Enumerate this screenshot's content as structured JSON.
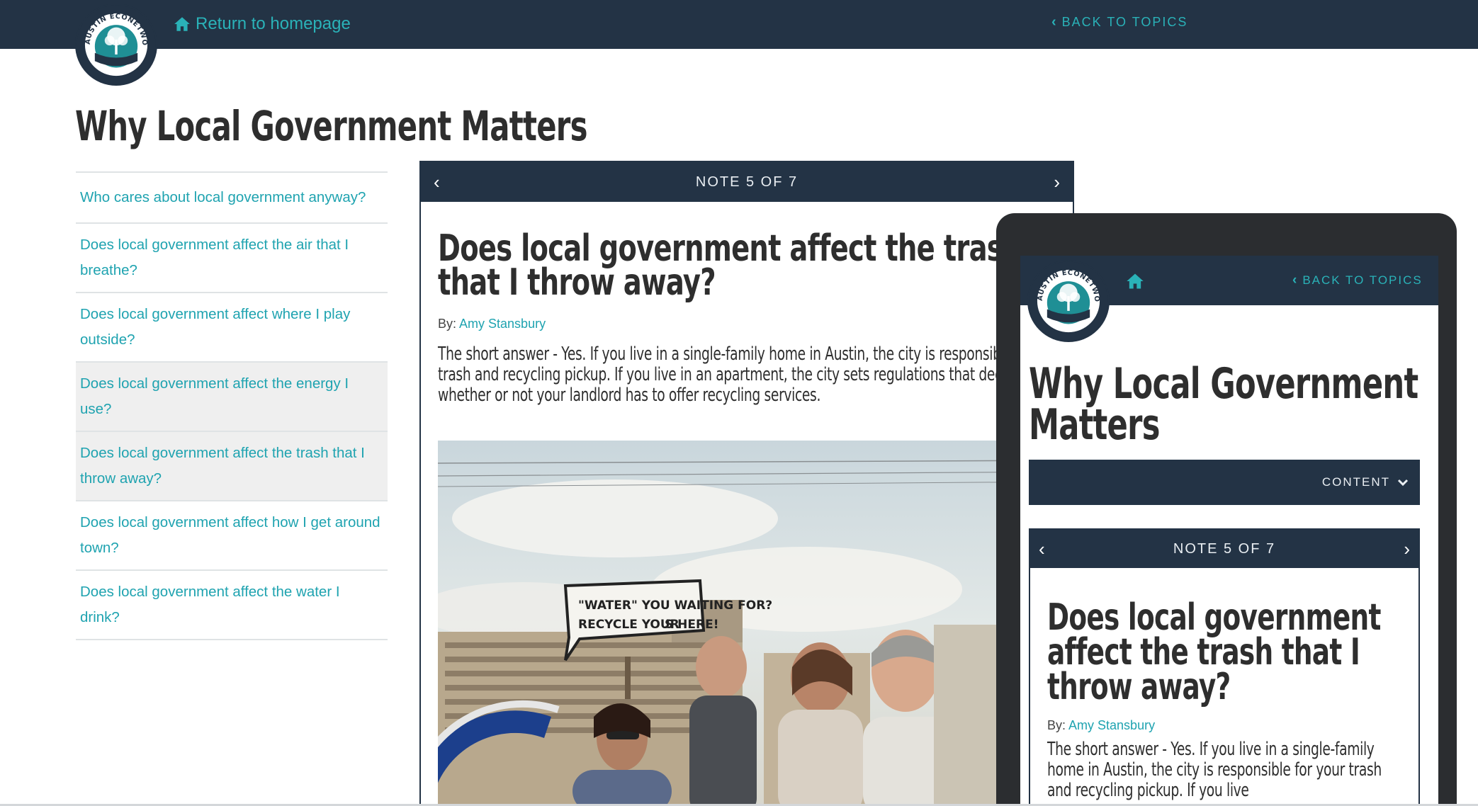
{
  "nav": {
    "home_link": "Return to homepage",
    "back_link": "BACK TO TOPICS"
  },
  "logo": {
    "text": "AUSTIN ECONETWORK"
  },
  "page": {
    "title": "Why Local Government Matters"
  },
  "toc": {
    "items": [
      {
        "label": "Who cares about local government anyway?"
      },
      {
        "label": "Does local government affect the air that I breathe?"
      },
      {
        "label": "Does local government affect where I play outside?"
      },
      {
        "label": "Does local government affect the energy I use?"
      },
      {
        "label": "Does local government affect the trash that I throw away?"
      },
      {
        "label": "Does local government affect how I get around town?"
      },
      {
        "label": "Does local government affect the water I drink?"
      }
    ]
  },
  "note": {
    "counter": "NOTE 5 OF 7",
    "title": "Does local government affect the trash that I throw away?",
    "by_label": "By:",
    "author": "Amy Stansbury",
    "text": "The short answer - Yes. If you live in a single-family home in Austin, the city is responsible for your trash and recycling pickup. If you live in an apartment, the city sets regulations that decide whether or not your landlord has to offer recycling services.",
    "photo_sign_line1": "\"WATER\" YOU WAITING FOR?",
    "photo_sign_line2": "RECYCLE YOUR",
    "photo_sign_line3": "S HERE!"
  },
  "tablet": {
    "back_link": "BACK TO TOPICS",
    "title": "Why Local Government Matters",
    "content_label": "CONTENT",
    "note_counter": "NOTE 5 OF 7",
    "note_title": "Does local government affect the trash that I throw away?",
    "by_label": "By:",
    "author": "Amy Stansbury",
    "note_text": "The short answer - Yes. If you live in a single-family home in Austin, the city is responsible for your trash and recycling pickup. If you live"
  },
  "colors": {
    "navy": "#233345",
    "teal": "#2ab2b8",
    "link_teal": "#1fa3b0",
    "text_dark": "#2e2e2e",
    "active_bg": "#efefef"
  },
  "icons": {
    "home": "home-icon",
    "back": "chevron-left-icon",
    "prev": "chevron-left-icon",
    "next": "chevron-right-icon",
    "dropdown": "chevron-down-icon"
  }
}
